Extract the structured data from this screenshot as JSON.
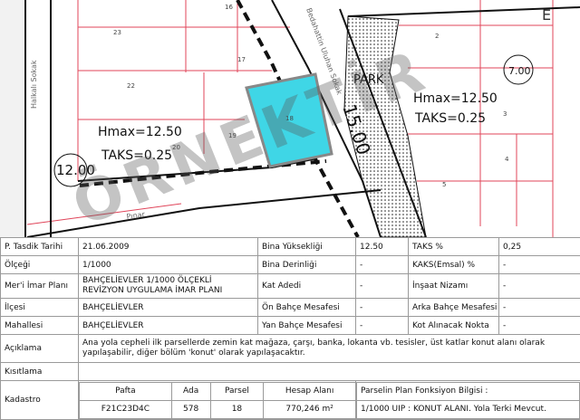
{
  "map": {
    "parcel_numbers": [
      "23",
      "16",
      "17",
      "22",
      "18",
      "19",
      "20",
      "2",
      "3",
      "4",
      "5",
      "E"
    ],
    "street_left": "Halkalı Sokak",
    "street_mid": "Bedahattin Uluhan Sokak",
    "street_bottom": "Pınar",
    "park_label": "PARK",
    "elev_left": "12.00",
    "elev_right": "7.00",
    "road_width_label": "15.00",
    "zone_left": {
      "hmax": "Hmax=12.50",
      "taks": "TAKS=0.25"
    },
    "zone_right": {
      "hmax": "Hmax=12.50",
      "taks": "TAKS=0.25"
    },
    "watermark": "ÖRNEKTİR",
    "colors": {
      "parcel_line": "#e0455a",
      "road_line": "#111111",
      "highlight": "#3fd6e6",
      "park_hatch": "#222222"
    }
  },
  "info": {
    "row1": {
      "l1": "P. Tasdik Tarihi",
      "v1": "21.06.2009",
      "l2": "Bina Yüksekliği",
      "v2": "12.50",
      "l3": "TAKS %",
      "v3": "0,25"
    },
    "row2": {
      "l1": "Ölçeği",
      "v1": "1/1000",
      "l2": "Bina Derinliği",
      "v2": "-",
      "l3": "KAKS(Emsal) %",
      "v3": "-"
    },
    "row3": {
      "l1": "Mer'i İmar Planı",
      "v1": "BAHÇELİEVLER 1/1000 ÖLÇEKLİ REVİZYON UYGULAMA İMAR PLANI",
      "l2": "Kat Adedi",
      "v2": "-",
      "l3": "İnşaat Nizamı",
      "v3": "-"
    },
    "row4": {
      "l1": "İlçesi",
      "v1": "BAHÇELİEVLER",
      "l2": "Ön Bahçe Mesafesi",
      "v2": "-",
      "l3": "Arka Bahçe Mesafesi",
      "v3": "-"
    },
    "row5": {
      "l1": "Mahallesi",
      "v1": "BAHÇELİEVLER",
      "l2": "Yan Bahçe Mesafesi",
      "v2": "-",
      "l3": "Kot Alınacak Nokta",
      "v3": "-"
    },
    "aciklama_label": "Açıklama",
    "aciklama": "Ana yola cepheli ilk parsellerde zemin kat mağaza, çarşı, banka, lokanta vb. tesisler, üst katlar konut alanı olarak yapılaşabilir, diğer bölüm 'konut' olarak yapılaşacaktır.",
    "kisitlama_label": "Kısıtlama",
    "kisitlama": "",
    "kadastro": {
      "label": "Kadastro",
      "headers": [
        "Pafta",
        "Ada",
        "Parsel",
        "Hesap Alanı"
      ],
      "values": [
        "F21C23D4C",
        "578",
        "18",
        "770,246 m²"
      ],
      "fonksiyon_label": "Parselin Plan Fonksiyon Bilgisi :",
      "fonksiyon": "1/1000 UIP : KONUT ALANI. Yola Terki Mevcut."
    }
  }
}
